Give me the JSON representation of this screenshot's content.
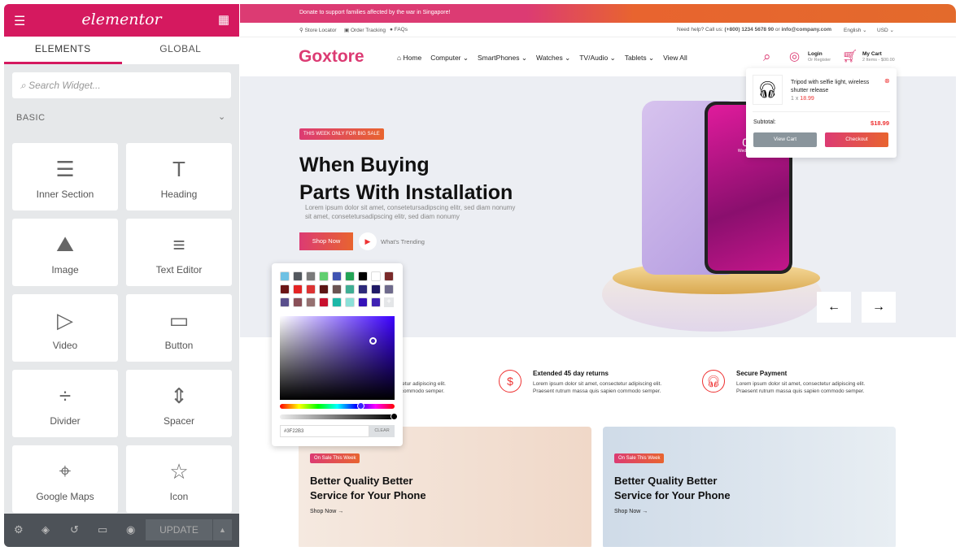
{
  "panel": {
    "logo": "elementor",
    "tabs": [
      "ELEMENTS",
      "GLOBAL"
    ],
    "search_placeholder": "Search Widget...",
    "section": "BASIC",
    "widgets": [
      {
        "label": "Inner Section",
        "icon": "inner-section-icon"
      },
      {
        "label": "Heading",
        "icon": "heading-icon"
      },
      {
        "label": "Image",
        "icon": "image-icon"
      },
      {
        "label": "Text Editor",
        "icon": "text-editor-icon"
      },
      {
        "label": "Video",
        "icon": "video-icon"
      },
      {
        "label": "Button",
        "icon": "button-icon"
      },
      {
        "label": "Divider",
        "icon": "divider-icon"
      },
      {
        "label": "Spacer",
        "icon": "spacer-icon"
      },
      {
        "label": "Google Maps",
        "icon": "google-maps-icon"
      },
      {
        "label": "Icon",
        "icon": "star-icon"
      }
    ],
    "update": "UPDATE",
    "accent": "#d5195f"
  },
  "site": {
    "banner": "Donate to support families affected by the war in Singapore!",
    "topbar": {
      "links": [
        "Store Locator",
        "Order Tracking",
        "FAQs"
      ],
      "help_prefix": "Need help? Call us:",
      "phone": "(+800) 1234 5678 90",
      "or": "or",
      "email": "info@company.com",
      "language": "English",
      "currency": "USD"
    },
    "logo": "Goxtore",
    "nav": [
      "Home",
      "Computer",
      "SmartPhones",
      "Watches",
      "TV/Audio",
      "Tablets",
      "View All"
    ],
    "login": "Login",
    "register": "Or Register",
    "cart_title": "My Cart",
    "cart_sub": "2 Items - $00.00",
    "cart": {
      "item": "Tripod with selfie light, wireless shutter release",
      "qty": "1 x",
      "price": "18.99",
      "subtotal_label": "Subtotal:",
      "subtotal": "$18.99",
      "view_cart": "View Cart",
      "checkout": "Checkout"
    },
    "hero": {
      "badge": "THIS WEEK ONLY FOR BIG SALE",
      "title1": "When Buying",
      "title2": "Parts With Installation",
      "text1": "Lorem ipsum dolor sit amet, consetetursadipscing elitr, sed diam nonumy",
      "text2": "sit amet, consetetursadipscing elitr, sed diam nonumy",
      "shop": "Shop Now",
      "trending": "What's Trending",
      "phone_time": "09",
      "phone_day": "Wednesday"
    },
    "features": [
      {
        "title": "t",
        "text1": "onsectetur adipiscing elit.",
        "text2": "apien commodo semper."
      },
      {
        "title": "Extended 45 day returns",
        "text1": "Lorem ipsum dolor sit amet, consectetur adipiscing elit.",
        "text2": "Praesent rutrum massa quis sapien commodo semper."
      },
      {
        "title": "Secure Payment",
        "text1": "Lorem ipsum dolor sit amet, consectetur adipiscing elit.",
        "text2": "Praesent rutrum massa quis sapien commodo semper."
      }
    ],
    "promos": [
      {
        "badge": "On Sale This Week",
        "title1": "Better Quality Better",
        "title2": "Service for Your Phone",
        "link": "Shop Now"
      },
      {
        "badge": "On Sale This Week",
        "title1": "Better Quality Better",
        "title2": "Service for Your Phone",
        "link": "Shop Now"
      }
    ]
  },
  "color_picker": {
    "hex": "#3F22B3",
    "clear": "CLEAR",
    "swatches": [
      "#6ec1e4",
      "#54595f",
      "#7a7a7a",
      "#61ce70",
      "#4054b2",
      "#23a455",
      "#000000",
      "#ffffff",
      "#7a2a2a",
      "#6b1515",
      "#e42424",
      "#dd3333",
      "#5c1414",
      "#6b5452",
      "#3fae94",
      "#2d2a7a",
      "#201a66",
      "#6e6a8c",
      "#5a4f8c",
      "#8a5058",
      "#957171",
      "#c8102e",
      "#1cb8a8",
      "#8be0d8",
      "#3512b8",
      "#3f22b3"
    ]
  }
}
